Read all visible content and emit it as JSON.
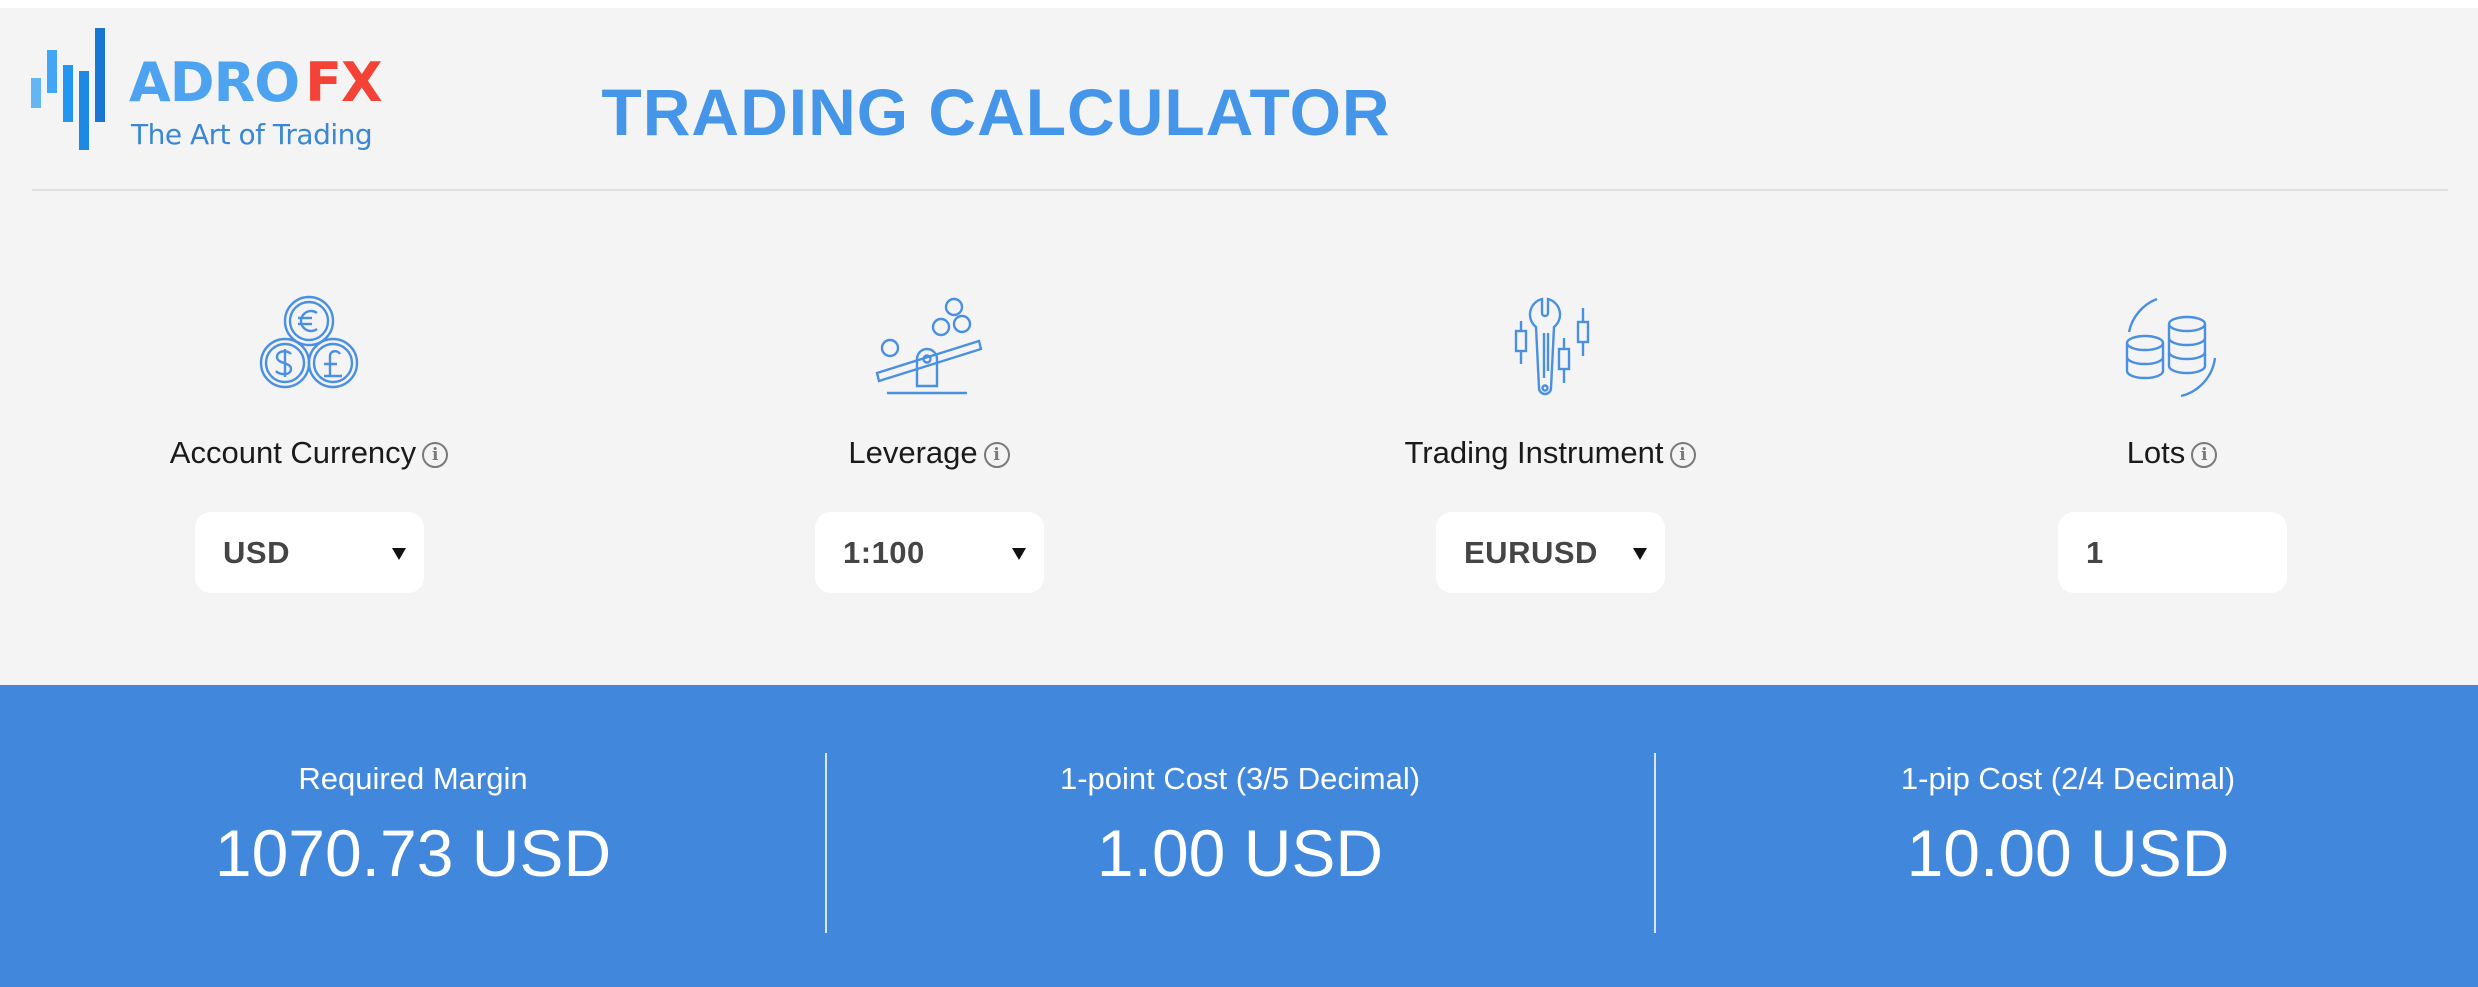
{
  "header": {
    "logo": {
      "brand_primary": "ADRO",
      "brand_accent": "FX",
      "tagline": "The Art of Trading",
      "colors": {
        "primary": "#4ea3f1",
        "accent": "#f44336"
      }
    },
    "title": "TRADING CALCULATOR",
    "title_color": "#4596e9"
  },
  "fields": [
    {
      "icon": "currency-coins-icon",
      "label": "Account Currency",
      "info_icon": "info-icon",
      "type": "select",
      "value": "USD"
    },
    {
      "icon": "leverage-seesaw-icon",
      "label": "Leverage",
      "info_icon": "info-icon",
      "type": "select",
      "value": "1:100"
    },
    {
      "icon": "wrench-candlestick-icon",
      "label": "Trading Instrument",
      "info_icon": "info-icon",
      "type": "select",
      "value": "EURUSD"
    },
    {
      "icon": "coin-stacks-icon",
      "label": "Lots",
      "info_icon": "info-icon",
      "type": "input",
      "value": "1"
    }
  ],
  "info_glyph": "i",
  "results": {
    "background": "#4188dd",
    "items": [
      {
        "label": "Required Margin",
        "value": "1070.73 USD"
      },
      {
        "label": "1-point Cost (3/5 Decimal)",
        "value": "1.00 USD"
      },
      {
        "label": "1-pip Cost (2/4 Decimal)",
        "value": "10.00 USD"
      }
    ]
  }
}
